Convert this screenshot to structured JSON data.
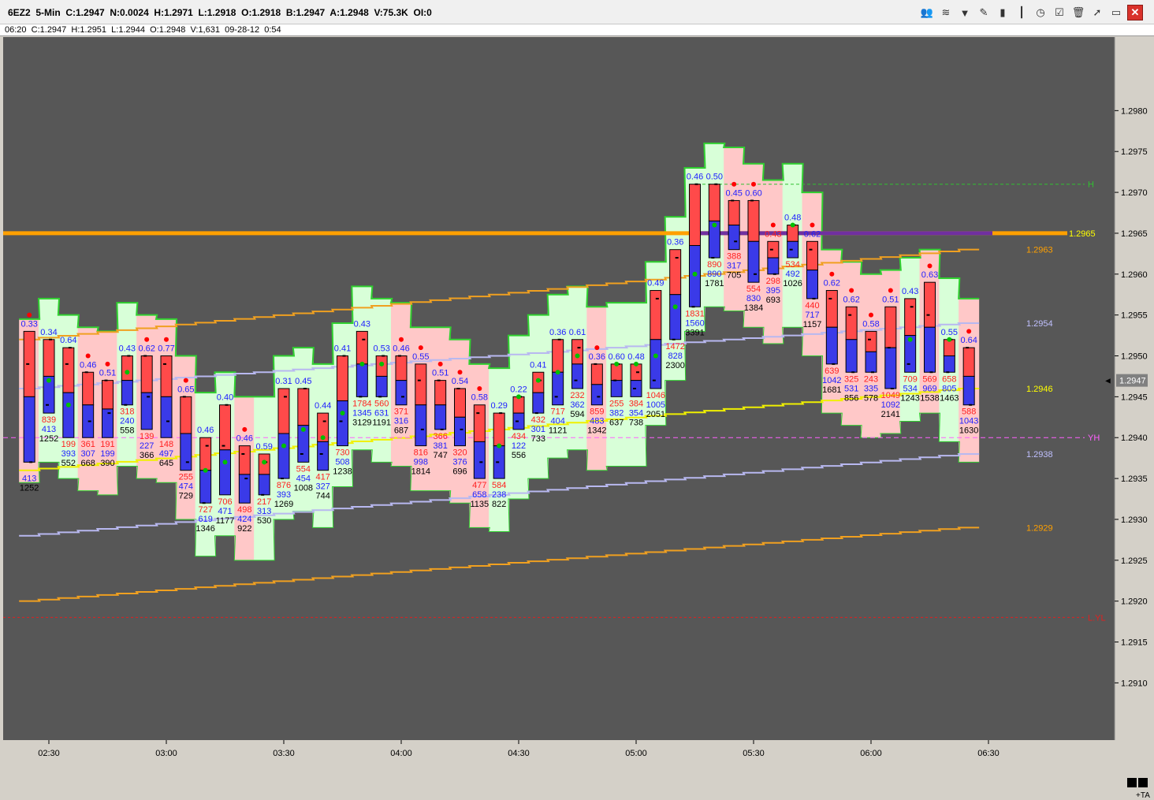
{
  "window": {
    "title": "6EZ2  5-Min  C:1.2947  N:0.0024  H:1.2971  L:1.2918  O:1.2918  B:1.2947  A:1.2948  V:75.3K  OI:0",
    "info": "06:20  C:1.2947  H:1.2951  L:1.2944  O:1.2948  V:1,631  09-28-12  0:54",
    "toolbar_icons": [
      "people-icon",
      "rainbow-icon",
      "funnel-icon",
      "pencil-icon",
      "bar-chart-icon",
      "candle-icon",
      "clock-icon",
      "checklist-icon",
      "trash-icon",
      "cursor-icon",
      "restore-icon",
      "close-icon"
    ],
    "corner_label": "+TA"
  },
  "colors": {
    "background": "#575757",
    "bull_fill": "#ff4a4a",
    "bear_fill": "#3a3ae8",
    "green_band": "#d8ffd8",
    "red_band": "#ffc8c8",
    "orange": "#f0a020",
    "yellow": "#f0f000",
    "lavender": "#b8b8f0",
    "green_dot": "#00c000",
    "red_dot": "#ff0000",
    "current_price_box": "#808080"
  },
  "chart_data": {
    "type": "candlestick",
    "symbol": "6EZ2",
    "interval": "5-Min",
    "ylim": [
      1.2903,
      1.2989
    ],
    "y_ticks": [
      "1.2910",
      "1.2915",
      "1.2920",
      "1.2925",
      "1.2930",
      "1.2935",
      "1.2940",
      "1.2945",
      "1.2950",
      "1.2955",
      "1.2960",
      "1.2965",
      "1.2970",
      "1.2975",
      "1.2980"
    ],
    "x_ticks": [
      {
        "label": "02:30",
        "minute": 150
      },
      {
        "label": "03:00",
        "minute": 180
      },
      {
        "label": "03:30",
        "minute": 210
      },
      {
        "label": "04:00",
        "minute": 240
      },
      {
        "label": "04:30",
        "minute": 270
      },
      {
        "label": "05:00",
        "minute": 300
      },
      {
        "label": "05:30",
        "minute": 330
      },
      {
        "label": "06:00",
        "minute": 360
      },
      {
        "label": "06:30",
        "minute": 390
      }
    ],
    "bars": [
      {
        "m": 145,
        "o": 1.2949,
        "c": 1.2937,
        "h": 1.2953,
        "l": 1.2937,
        "top": "0.33",
        "topc": "b",
        "bot": [
          "",
          "413",
          "1252"
        ]
      },
      {
        "m": 150,
        "o": 1.2944,
        "c": 1.2952,
        "h": 1.2952,
        "l": 1.2943,
        "top": "0.34",
        "topc": "b",
        "bot": [
          "839",
          "413",
          "1252"
        ]
      },
      {
        "m": 155,
        "o": 1.2949,
        "c": 1.2951,
        "h": 1.2951,
        "l": 1.294,
        "top": "0.64",
        "topc": "b",
        "bot": [
          "199",
          "393",
          "552"
        ]
      },
      {
        "m": 160,
        "o": 1.2948,
        "c": 1.2942,
        "h": 1.2948,
        "l": 1.294,
        "top": "0.46",
        "topc": "b",
        "bot": [
          "361",
          "307",
          "668"
        ]
      },
      {
        "m": 165,
        "o": 1.2947,
        "c": 1.2943,
        "h": 1.2947,
        "l": 1.294,
        "top": "0.51",
        "topc": "b",
        "bot": [
          "191",
          "199",
          "390"
        ]
      },
      {
        "m": 170,
        "o": 1.2944,
        "c": 1.295,
        "h": 1.295,
        "l": 1.2944,
        "top": "0.43",
        "topc": "b",
        "bot": [
          "318",
          "240",
          "558"
        ]
      },
      {
        "m": 175,
        "o": 1.295,
        "c": 1.2945,
        "h": 1.295,
        "l": 1.2941,
        "top": "0.62",
        "topc": "b",
        "bot": [
          "139",
          "227",
          "366"
        ]
      },
      {
        "m": 180,
        "o": 1.2949,
        "c": 1.2942,
        "h": 1.295,
        "l": 1.294,
        "top": "0.77",
        "topc": "b",
        "bot": [
          "148",
          "497",
          "645"
        ]
      },
      {
        "m": 185,
        "o": 1.2945,
        "c": 1.2937,
        "h": 1.2945,
        "l": 1.2936,
        "top": "0.65",
        "topc": "b",
        "bot": [
          "255",
          "474",
          "729"
        ]
      },
      {
        "m": 190,
        "o": 1.2932,
        "c": 1.2939,
        "h": 1.294,
        "l": 1.2932,
        "top": "0.46",
        "topc": "b",
        "bot": [
          "727",
          "619",
          "1346"
        ]
      },
      {
        "m": 195,
        "o": 1.2939,
        "c": 1.2944,
        "h": 1.2944,
        "l": 1.2933,
        "top": "0.40",
        "topc": "b",
        "bot": [
          "706",
          "471",
          "1177"
        ]
      },
      {
        "m": 200,
        "o": 1.2938,
        "c": 1.2935,
        "h": 1.2939,
        "l": 1.2932,
        "top": "0.46",
        "topc": "b",
        "bot": [
          "498",
          "424",
          "922"
        ]
      },
      {
        "m": 205,
        "o": 1.2933,
        "c": 1.2937,
        "h": 1.2938,
        "l": 1.2933,
        "top": "0.59",
        "topc": "b",
        "bot": [
          "217",
          "313",
          "530"
        ]
      },
      {
        "m": 210,
        "o": 1.2935,
        "c": 1.2945,
        "h": 1.2946,
        "l": 1.2935,
        "top": "0.31",
        "topc": "b",
        "bot": [
          "876",
          "393",
          "1269"
        ]
      },
      {
        "m": 215,
        "o": 1.2938,
        "c": 1.2946,
        "h": 1.2946,
        "l": 1.2937,
        "top": "0.45",
        "topc": "b",
        "bot": [
          "554",
          "454",
          "1008"
        ]
      },
      {
        "m": 220,
        "o": 1.2938,
        "c": 1.2942,
        "h": 1.2943,
        "l": 1.2936,
        "top": "0.44",
        "topc": "b",
        "bot": [
          "417",
          "327",
          "744"
        ]
      },
      {
        "m": 225,
        "o": 1.2942,
        "c": 1.295,
        "h": 1.295,
        "l": 1.2939,
        "top": "0.41",
        "topc": "b",
        "bot": [
          "730",
          "508",
          "1238"
        ]
      },
      {
        "m": 230,
        "o": 1.2945,
        "c": 1.2952,
        "h": 1.2953,
        "l": 1.2945,
        "top": "0.43",
        "topc": "b",
        "bot": [
          "1784",
          "1345",
          "3129"
        ]
      },
      {
        "m": 235,
        "o": 1.2945,
        "c": 1.295,
        "h": 1.295,
        "l": 1.2945,
        "top": "0.53",
        "topc": "b",
        "bot": [
          "560",
          "631",
          "1191"
        ]
      },
      {
        "m": 240,
        "o": 1.295,
        "c": 1.2945,
        "h": 1.295,
        "l": 1.2944,
        "top": "0.46",
        "topc": "b",
        "bot": [
          "371",
          "316",
          "687"
        ]
      },
      {
        "m": 245,
        "o": 1.2947,
        "c": 1.2941,
        "h": 1.2949,
        "l": 1.2939,
        "top": "0.55",
        "topc": "b",
        "bot": [
          "816",
          "998",
          "1814"
        ]
      },
      {
        "m": 250,
        "o": 1.2947,
        "c": 1.2941,
        "h": 1.2947,
        "l": 1.2941,
        "top": "0.51",
        "topc": "b",
        "bot": [
          "366",
          "381",
          "747"
        ]
      },
      {
        "m": 255,
        "o": 1.2946,
        "c": 1.2941,
        "h": 1.2946,
        "l": 1.2939,
        "top": "0.54",
        "topc": "b",
        "bot": [
          "320",
          "376",
          "696"
        ]
      },
      {
        "m": 260,
        "o": 1.2943,
        "c": 1.2937,
        "h": 1.2944,
        "l": 1.2935,
        "top": "0.58",
        "topc": "b",
        "bot": [
          "477",
          "658",
          "1135"
        ]
      },
      {
        "m": 265,
        "o": 1.2937,
        "c": 1.2943,
        "h": 1.2943,
        "l": 1.2935,
        "top": "0.29",
        "topc": "b",
        "bot": [
          "584",
          "238",
          "822"
        ]
      },
      {
        "m": 270,
        "o": 1.2942,
        "c": 1.2945,
        "h": 1.2945,
        "l": 1.2941,
        "top": "0.22",
        "topc": "b",
        "bot": [
          "434",
          "122",
          "556"
        ]
      },
      {
        "m": 275,
        "o": 1.2943,
        "c": 1.2947,
        "h": 1.2948,
        "l": 1.2943,
        "top": "0.41",
        "topc": "b",
        "bot": [
          "432",
          "301",
          "733"
        ]
      },
      {
        "m": 280,
        "o": 1.2945,
        "c": 1.2952,
        "h": 1.2952,
        "l": 1.2944,
        "top": "0.36",
        "topc": "b",
        "bot": [
          "717",
          "404",
          "1121"
        ]
      },
      {
        "m": 285,
        "o": 1.2947,
        "c": 1.2951,
        "h": 1.2952,
        "l": 1.2946,
        "top": "0.61",
        "topc": "b",
        "bot": [
          "232",
          "362",
          "594"
        ]
      },
      {
        "m": 290,
        "o": 1.2949,
        "c": 1.2945,
        "h": 1.2949,
        "l": 1.2944,
        "top": "0.36",
        "topc": "b",
        "bot": [
          "859",
          "483",
          "1342"
        ]
      },
      {
        "m": 295,
        "o": 1.2947,
        "c": 1.2949,
        "h": 1.2949,
        "l": 1.2945,
        "top": "0.60",
        "topc": "b",
        "bot": [
          "255",
          "382",
          "637"
        ]
      },
      {
        "m": 300,
        "o": 1.2946,
        "c": 1.2948,
        "h": 1.2949,
        "l": 1.2945,
        "top": "0.48",
        "topc": "b",
        "bot": [
          "384",
          "354",
          "738"
        ]
      },
      {
        "m": 305,
        "o": 1.2947,
        "c": 1.2957,
        "h": 1.2958,
        "l": 1.2946,
        "top": "0.49",
        "topc": "b",
        "bot": [
          "1046",
          "1005",
          "2051"
        ]
      },
      {
        "m": 310,
        "o": 1.2952,
        "c": 1.2962,
        "h": 1.2963,
        "l": 1.2952,
        "top": "0.36",
        "topc": "b",
        "bot": [
          "1472",
          "828",
          "2300"
        ]
      },
      {
        "m": 315,
        "o": 1.2956,
        "c": 1.2971,
        "h": 1.2971,
        "l": 1.2956,
        "top": "0.46",
        "topc": "b",
        "bot": [
          "1831",
          "1560",
          "3391"
        ]
      },
      {
        "m": 320,
        "o": 1.2962,
        "c": 1.2971,
        "h": 1.2971,
        "l": 1.2962,
        "top": "0.50",
        "topc": "b",
        "bot": [
          "890",
          "890",
          "1781"
        ]
      },
      {
        "m": 325,
        "o": 1.2969,
        "c": 1.2964,
        "h": 1.2969,
        "l": 1.2963,
        "top": "0.45",
        "topc": "b",
        "bot": [
          "388",
          "317",
          "705"
        ]
      },
      {
        "m": 330,
        "o": 1.2969,
        "c": 1.296,
        "h": 1.2969,
        "l": 1.2959,
        "top": "0.60",
        "topc": "b",
        "bot": [
          "554",
          "830",
          "1384"
        ]
      },
      {
        "m": 335,
        "o": 1.2963,
        "c": 1.296,
        "h": 1.2964,
        "l": 1.296,
        "top": "0.43",
        "topc": "r",
        "bot": [
          "298",
          "395",
          "693"
        ]
      },
      {
        "m": 340,
        "o": 1.2963,
        "c": 1.2966,
        "h": 1.2966,
        "l": 1.2962,
        "top": "0.48",
        "topc": "b",
        "bot": [
          "534",
          "492",
          "1026"
        ]
      },
      {
        "m": 345,
        "o": 1.2963,
        "c": 1.2957,
        "h": 1.2964,
        "l": 1.2957,
        "top": "0.62",
        "topc": "b",
        "bot": [
          "440",
          "717",
          "1157"
        ]
      },
      {
        "m": 350,
        "o": 1.2957,
        "c": 1.2949,
        "h": 1.2958,
        "l": 1.2949,
        "top": "0.62",
        "topc": "b",
        "bot": [
          "639",
          "1042",
          "1681"
        ]
      },
      {
        "m": 355,
        "o": 1.2955,
        "c": 1.2948,
        "h": 1.2956,
        "l": 1.2948,
        "top": "0.62",
        "topc": "b",
        "bot": [
          "325",
          "531",
          "856"
        ]
      },
      {
        "m": 360,
        "o": 1.2952,
        "c": 1.2948,
        "h": 1.2953,
        "l": 1.2948,
        "top": "0.58",
        "topc": "b",
        "bot": [
          "243",
          "335",
          "578"
        ]
      },
      {
        "m": 365,
        "o": 1.2951,
        "c": 1.2946,
        "h": 1.2956,
        "l": 1.2946,
        "top": "0.51",
        "topc": "b",
        "bot": [
          "1049",
          "1092",
          "2141"
        ]
      },
      {
        "m": 370,
        "o": 1.2949,
        "c": 1.2956,
        "h": 1.2957,
        "l": 1.2948,
        "top": "0.43",
        "topc": "b",
        "bot": [
          "709",
          "534",
          "1243"
        ]
      },
      {
        "m": 375,
        "o": 1.2955,
        "c": 1.2948,
        "h": 1.2959,
        "l": 1.2948,
        "top": "0.63",
        "topc": "b",
        "bot": [
          "569",
          "969",
          "1538"
        ]
      },
      {
        "m": 380,
        "o": 1.2948,
        "c": 1.2952,
        "h": 1.2952,
        "l": 1.2948,
        "top": "0.55",
        "topc": "b",
        "bot": [
          "658",
          "805",
          "1463"
        ]
      },
      {
        "m": 385,
        "o": 1.2951,
        "c": 1.2944,
        "h": 1.2951,
        "l": 1.2944,
        "top": "0.64",
        "topc": "b",
        "bot": [
          "588",
          "1043",
          "1630"
        ]
      }
    ],
    "levels": [
      {
        "name": "H",
        "value": 1.2971,
        "color": "#30c030",
        "dash": "4,3",
        "label": "H"
      },
      {
        "name": "YH",
        "value": 1.294,
        "color": "#ff60ff",
        "dash": "6,4",
        "label": "YH"
      },
      {
        "name": "L",
        "value": 1.2918,
        "color": "#e02020",
        "dash": "3,3",
        "label": "L.YL"
      },
      {
        "name": "pivot",
        "value": 1.2965,
        "color": "#ffa000",
        "dash": "",
        "label": "1.2965"
      }
    ],
    "right_labels": [
      {
        "text": "1.2963",
        "value": 1.2963,
        "color": "#ffa000"
      },
      {
        "text": "1.2954",
        "value": 1.2954,
        "color": "#c0c0ff"
      },
      {
        "text": "1.2946",
        "value": 1.2946,
        "color": "#ffff00"
      },
      {
        "text": "1.2938",
        "value": 1.2938,
        "color": "#c0c0ff"
      },
      {
        "text": "1.2929",
        "value": 1.2929,
        "color": "#ffa000"
      }
    ],
    "current_price": "1.2947",
    "current_value": 1.2947
  }
}
